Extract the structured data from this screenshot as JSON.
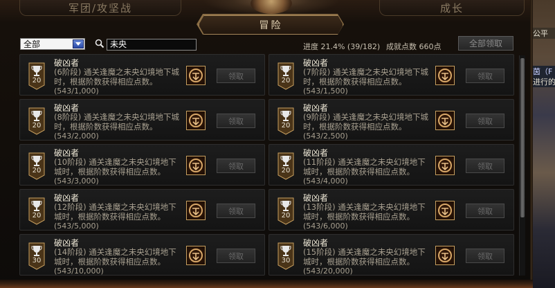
{
  "tabs": {
    "legion": "军团/攻坚战",
    "growth": "成长",
    "adventure": "冒险"
  },
  "filter": {
    "category": "全部",
    "search_value": "未央"
  },
  "stats": {
    "progress": "进度 21.4% (39/182)",
    "points": "成就点数 660点"
  },
  "claim_all_label": "全部领取",
  "claim_label": "领取",
  "right_side": {
    "text1": "公平",
    "text2": "茵（F",
    "text3": "进行的"
  },
  "colors": {
    "title": "#f0ead8",
    "desc": "#a8a090",
    "reward_border": "#c8a060"
  },
  "achievements": [
    {
      "title": "破凶者",
      "desc": "(6阶段) 通关逢魔之未央幻境地下城时，根据阶数获得相应点数。",
      "progress": "(543/1,000)",
      "points": "20"
    },
    {
      "title": "破凶者",
      "desc": "(7阶段) 通关逢魔之未央幻境地下城时，根据阶数获得相应点数。",
      "progress": "(543/1,500)",
      "points": "20"
    },
    {
      "title": "破凶者",
      "desc": "(8阶段) 通关逢魔之未央幻境地下城时，根据阶数获得相应点数。",
      "progress": "(543/2,000)",
      "points": "20"
    },
    {
      "title": "破凶者",
      "desc": "(9阶段) 通关逢魔之未央幻境地下城时，根据阶数获得相应点数。",
      "progress": "(543/2,500)",
      "points": "20"
    },
    {
      "title": "破凶者",
      "desc": "(10阶段) 通关逢魔之未央幻境地下城时，根据阶数获得相应点数。",
      "progress": "(543/3,000)",
      "points": "20"
    },
    {
      "title": "破凶者",
      "desc": "(11阶段) 通关逢魔之未央幻境地下城时，根据阶数获得相应点数。",
      "progress": "(543/4,000)",
      "points": "20"
    },
    {
      "title": "破凶者",
      "desc": "(12阶段) 通关逢魔之未央幻境地下城时，根据阶数获得相应点数。",
      "progress": "(543/5,000)",
      "points": "20"
    },
    {
      "title": "破凶者",
      "desc": "(13阶段) 通关逢魔之未央幻境地下城时，根据阶数获得相应点数。",
      "progress": "(543/6,000)",
      "points": "20"
    },
    {
      "title": "破凶者",
      "desc": "(14阶段) 通关逢魔之未央幻境地下城时，根据阶数获得相应点数。",
      "progress": "(543/10,000)",
      "points": "30"
    },
    {
      "title": "破凶者",
      "desc": "(15阶段) 通关逢魔之未央幻境地下城时，根据阶数获得相应点数。",
      "progress": "(543/20,000)",
      "points": "30"
    }
  ]
}
